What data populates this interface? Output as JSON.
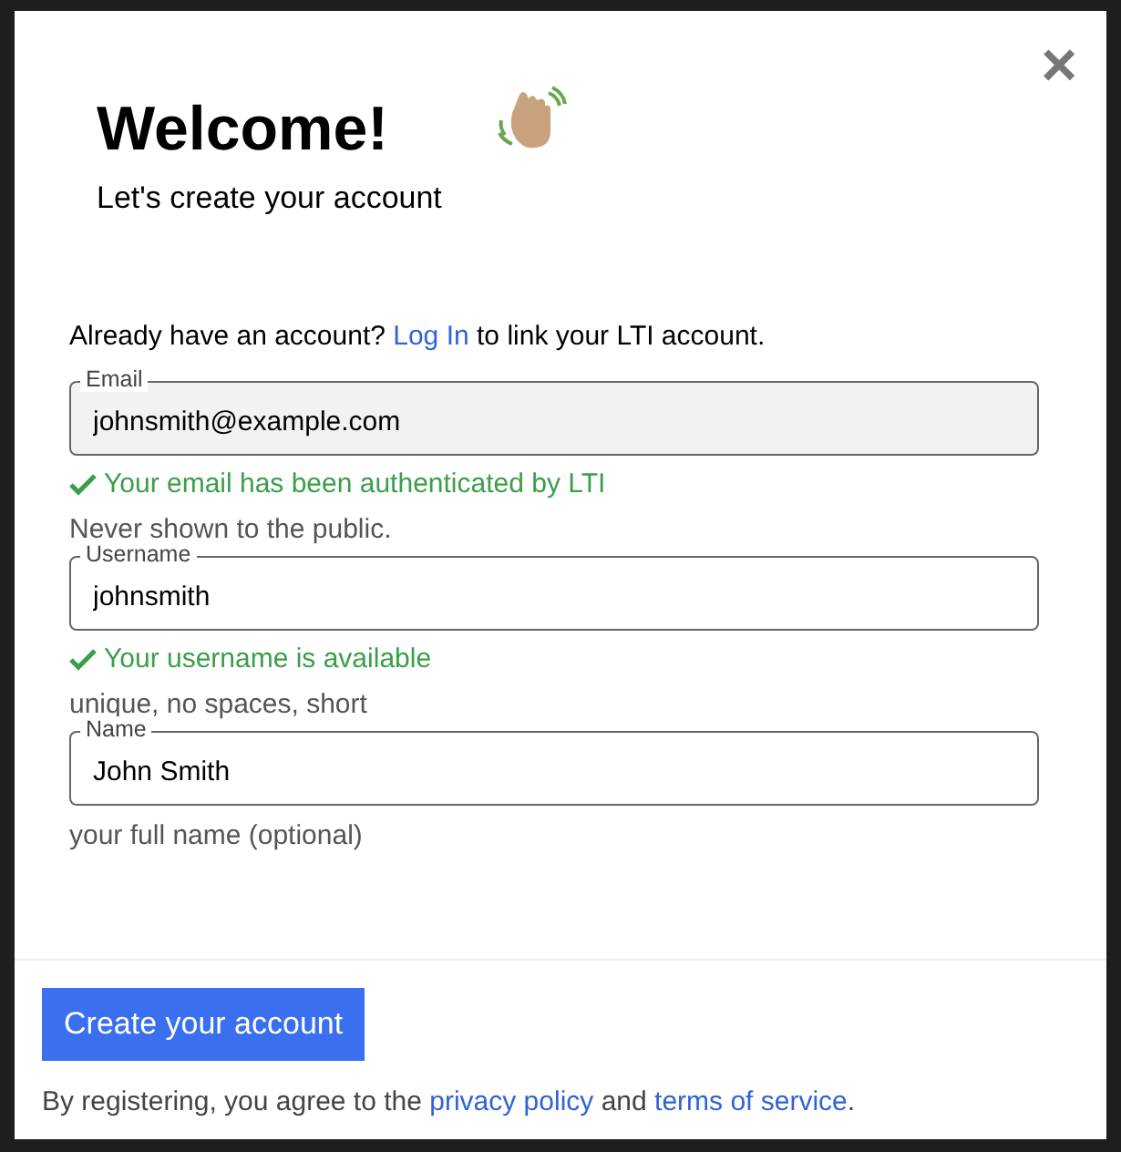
{
  "dialog": {
    "close": "×",
    "title": "Welcome!",
    "subtitle": "Let's create your account"
  },
  "login_prompt": {
    "before": "Already have an account? ",
    "link": "Log In",
    "after": " to link your LTI account."
  },
  "fields": [
    {
      "label": "Email",
      "value": "johnsmith@example.com",
      "disabled": true,
      "status": "Your email has been authenticated by LTI",
      "hint": "Never shown to the public."
    },
    {
      "label": "Username",
      "value": "johnsmith",
      "disabled": false,
      "status": "Your username is available",
      "hint": "unique, no spaces, short"
    },
    {
      "label": "Name",
      "value": "John Smith",
      "disabled": false,
      "hint": "your full name (optional)"
    }
  ],
  "submit_button": "Create your account",
  "terms": {
    "before": "By registering, you agree to the ",
    "link1": "privacy policy",
    "middle": " and ",
    "link2": "terms of service",
    "after": "."
  }
}
